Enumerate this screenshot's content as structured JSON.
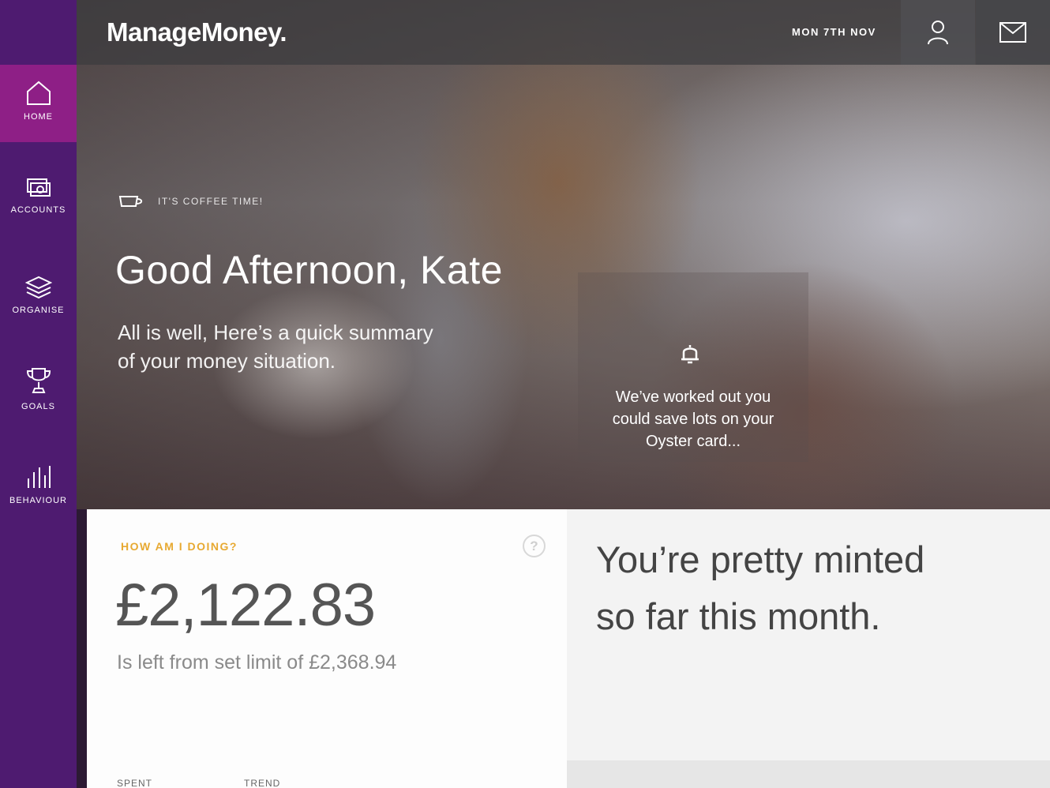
{
  "app": {
    "logo": "ManageMoney.",
    "date": "MON 7TH NOV"
  },
  "icons": {
    "user": "user-icon",
    "mail": "mail-icon",
    "coffee": "coffee-cup-icon",
    "bell": "bell-icon",
    "help": "question-icon"
  },
  "colors": {
    "sidebar": "#4e1b70",
    "active": "#8e1f86",
    "accent": "#e7a931"
  },
  "sidebar": {
    "items": [
      {
        "label": "HOME",
        "icon": "home-icon",
        "active": true
      },
      {
        "label": "ACCOUNTS",
        "icon": "accounts-icon",
        "active": false
      },
      {
        "label": "ORGANISE",
        "icon": "layers-icon",
        "active": false
      },
      {
        "label": "GOALS",
        "icon": "trophy-icon",
        "active": false
      },
      {
        "label": "BEHAVIOUR",
        "icon": "bar-chart-icon",
        "active": false
      }
    ]
  },
  "hero": {
    "tag": "IT'S COFFEE TIME!",
    "greeting": "Good Afternoon, Kate",
    "summary_line1": "All is well, Here’s a quick summary",
    "summary_line2": "of your money situation."
  },
  "notice": {
    "line1": "We’ve worked out you",
    "line2": "could save lots on your",
    "line3": "Oyster card..."
  },
  "status": {
    "heading": "HOW AM I DOING?",
    "help": "?",
    "amount": "£2,122.83",
    "limit_text": "Is left from set limit of £2,368.94",
    "col_spent": "SPENT",
    "col_trend": "TREND"
  },
  "verdict": {
    "line1": "You’re pretty minted",
    "line2": "so far this month."
  }
}
